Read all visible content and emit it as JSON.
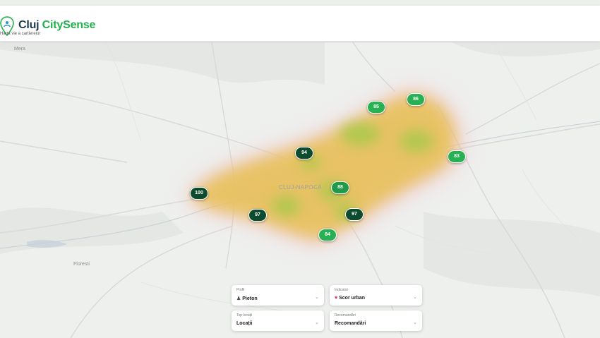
{
  "app": {
    "brand_part1": "Cluj",
    "brand_part2": "CitySense",
    "tagline": "Harta vie a cartierelor",
    "accent_color": "#22b14c",
    "brand_dark_color": "#1f3a4d"
  },
  "map": {
    "city_label": "CLUJ-NAPOCA",
    "places": [
      "Mera",
      "Floresti"
    ],
    "markers": [
      {
        "score": "85",
        "color": "#27b153"
      },
      {
        "score": "86",
        "color": "#27b153"
      },
      {
        "score": "94",
        "color": "#0d4b2e"
      },
      {
        "score": "83",
        "color": "#27b153"
      },
      {
        "score": "100",
        "color": "#0d4b2e"
      },
      {
        "score": "88",
        "color": "#1f9a4b"
      },
      {
        "score": "97",
        "color": "#0d4b2e"
      },
      {
        "score": "97",
        "color": "#0d4b2e"
      },
      {
        "score": "84",
        "color": "#27b153"
      }
    ]
  },
  "controls": {
    "profile": {
      "label": "Profil",
      "value": "Pieton",
      "icon": "pedestrian-icon"
    },
    "indicator": {
      "label": "Indicator",
      "value": "Scor urban",
      "icon": "heart-icon"
    },
    "top": {
      "label": "Top locații",
      "value": "Locații"
    },
    "recommend": {
      "label": "Recomandări",
      "value": "Recomandări"
    },
    "chevron": "⌄"
  }
}
